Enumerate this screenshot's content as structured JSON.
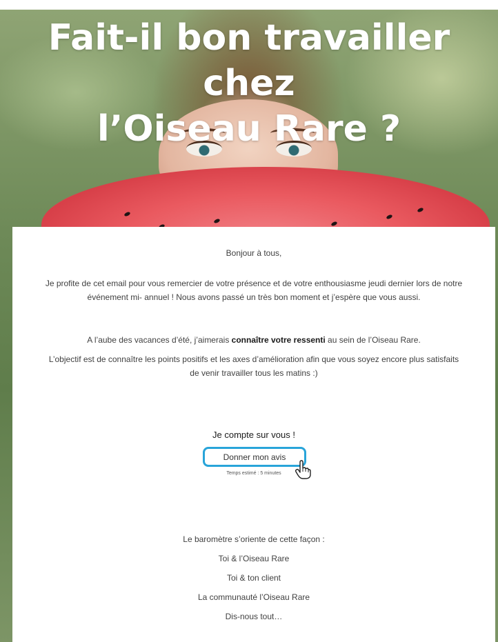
{
  "hero": {
    "title_line1": "Fait-il bon travailler chez",
    "title_line2": "l’Oiseau Rare ?"
  },
  "body": {
    "greeting": "Bonjour à tous,",
    "para1_line1": "Je profite de cet email pour vous remercier de votre présence et de votre enthousiasme jeudi dernier lors de notre",
    "para1_line2": "événement mi- annuel ! Nous avons passé un très bon moment et j’espère que vous aussi.",
    "para2_before": "A l’aube des vacances d’été, j’aimerais ",
    "para2_bold": "connaître votre ressenti",
    "para2_after": " au sein de l’Oiseau Rare.",
    "para3_line1": "L’objectif est de connaître les points positifs et les axes d’amélioration afin que vous soyez encore plus satisfaits",
    "para3_line2": "de venir travailler tous les matins :)"
  },
  "cta": {
    "heading": "Je compte sur vous !",
    "button_label": "Donner mon avis",
    "time_estimate": "Temps estimé : 5 minutes"
  },
  "barometer": {
    "intro": "Le baromètre s’oriente de cette façon :",
    "items": [
      "Toi & l’Oiseau Rare",
      "Toi & ton client",
      "La communauté l’Oiseau Rare",
      "Dis-nous tout…"
    ]
  },
  "colors": {
    "accent": "#28a4d9",
    "title_text": "#ffffff"
  },
  "icons": {
    "cursor": "hand-pointer-icon"
  }
}
